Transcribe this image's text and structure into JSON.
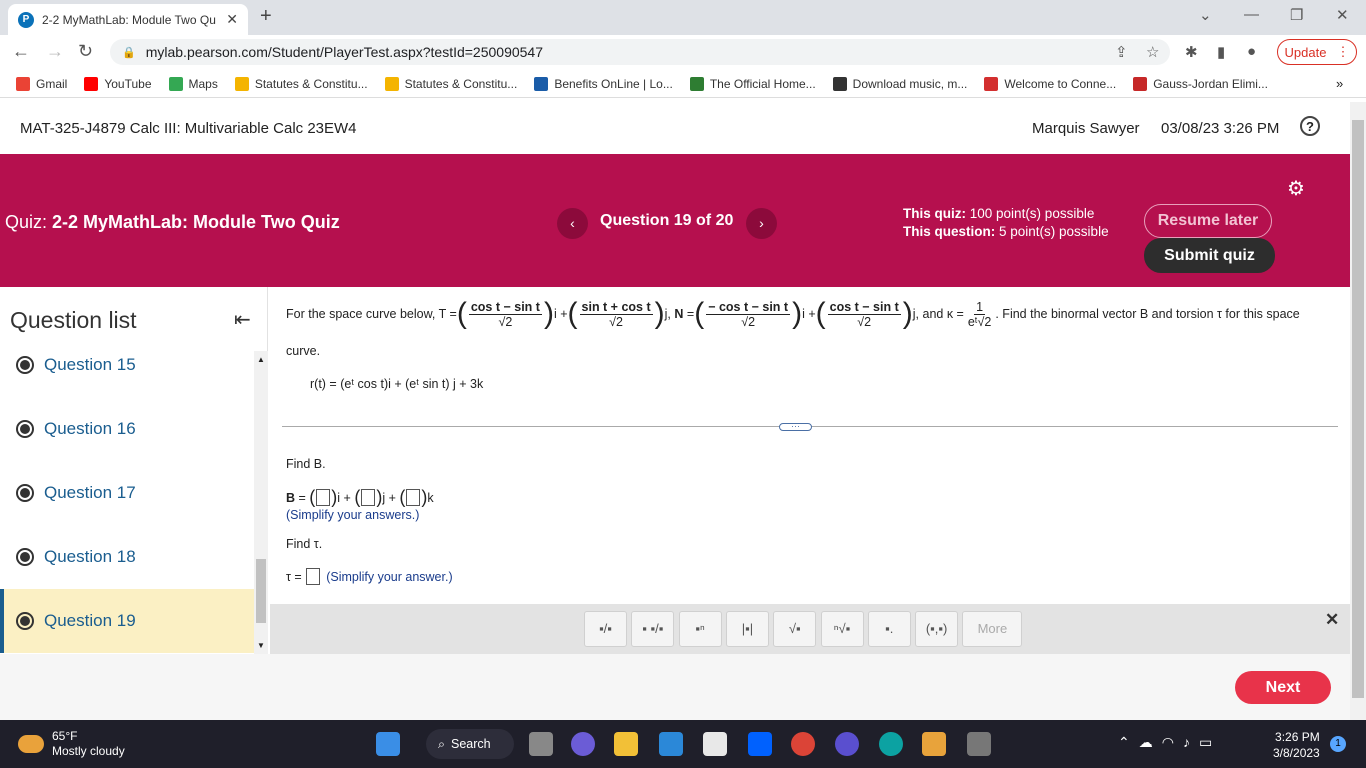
{
  "browser": {
    "tab_title": "2-2 MyMathLab: Module Two Qu",
    "tab_favicon": "P",
    "url": "mylab.pearson.com/Student/PlayerTest.aspx?testId=250090547",
    "update_label": "Update",
    "bookmarks": [
      {
        "label": "Gmail",
        "color": "#ea4335"
      },
      {
        "label": "YouTube",
        "color": "#ff0000"
      },
      {
        "label": "Maps",
        "color": "#34a853"
      },
      {
        "label": "Statutes & Constitu...",
        "color": "#f4b400"
      },
      {
        "label": "Statutes & Constitu...",
        "color": "#f4b400"
      },
      {
        "label": "Benefits OnLine | Lo...",
        "color": "#1a5ca8"
      },
      {
        "label": "The Official Home...",
        "color": "#2e7d32"
      },
      {
        "label": "Download music, m...",
        "color": "#333333"
      },
      {
        "label": "Welcome to Conne...",
        "color": "#d32f2f"
      },
      {
        "label": "Gauss-Jordan Elimi...",
        "color": "#c62828"
      }
    ]
  },
  "header": {
    "course": "MAT-325-J4879 Calc III: Multivariable Calc 23EW4",
    "user": "Marquis Sawyer",
    "datetime": "03/08/23 3:26 PM"
  },
  "quizbar": {
    "quiz_label": "Quiz:",
    "quiz_name": "2-2 MyMathLab: Module Two Quiz",
    "question_of": "Question 19 of 20",
    "this_quiz_label": "This quiz:",
    "this_quiz_value": "100 point(s) possible",
    "this_question_label": "This question:",
    "this_question_value": "5 point(s) possible",
    "resume_label": "Resume later",
    "submit_label": "Submit quiz"
  },
  "sidebar": {
    "title": "Question list",
    "items": [
      {
        "label": "Question 15"
      },
      {
        "label": "Question 16"
      },
      {
        "label": "Question 17"
      },
      {
        "label": "Question 18"
      },
      {
        "label": "Question 19"
      }
    ],
    "active_index": 4
  },
  "question": {
    "intro": "For the space curve below, T =",
    "T1n": "cos t − sin t",
    "T2n": "sin t + cos t",
    "den": "√2",
    "N1n": "− cos t − sin t",
    "N2n": "cos t − sin t",
    "kappa_n": "1",
    "kappa_d": "eᵗ√2",
    "tail": ". Find the binormal vector B and torsion τ for this space",
    "curve": "curve.",
    "rt": "r(t) = (eᵗ cos t)i + (eᵗ sin t) j + 3k",
    "findB": "Find B.",
    "simp1": "(Simplify your answers.)",
    "findT": "Find τ.",
    "simp2": "(Simplify your answer.)"
  },
  "mathbar": {
    "buttons": [
      "▪/▪",
      "▪ ▪/▪",
      "▪ⁿ",
      "|▪|",
      "√▪",
      "ⁿ√▪",
      "▪.",
      "(▪,▪)",
      "More"
    ]
  },
  "footer": {
    "next_label": "Next"
  },
  "taskbar": {
    "temp": "65°F",
    "weather": "Mostly cloudy",
    "search": "Search",
    "time": "3:26 PM",
    "date": "3/8/2023",
    "notif": "1"
  }
}
